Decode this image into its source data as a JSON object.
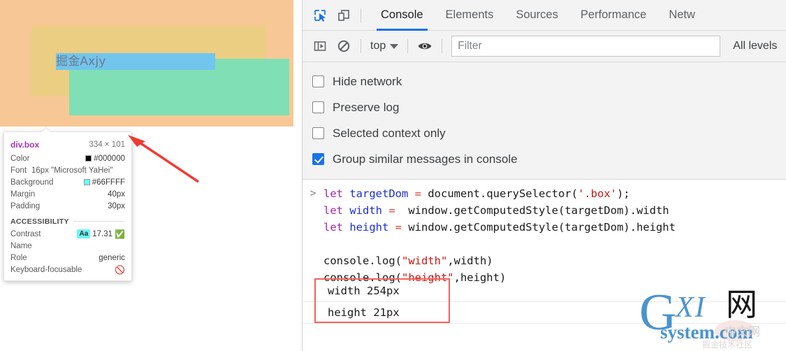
{
  "page": {
    "inspected_text": "掘金Axjy"
  },
  "inspect_tooltip": {
    "selector": "div.box",
    "dimensions": "334 × 101",
    "rows": [
      {
        "key": "Color",
        "value": "#000000",
        "swatch": "#000000"
      },
      {
        "key": "Background",
        "value": "#66FFFF",
        "swatch": "#66FFFF"
      },
      {
        "key": "Margin",
        "value": "40px"
      },
      {
        "key": "Padding",
        "value": "30px"
      }
    ],
    "font_key": "Font",
    "font_value": "16px \"Microsoft YaHei\"",
    "accessibility": {
      "heading": "ACCESSIBILITY",
      "contrast_key": "Contrast",
      "contrast_chip": "Aa",
      "contrast_value": "17.31",
      "contrast_status_icon": "check-circle-icon",
      "name_key": "Name",
      "name_value": "",
      "role_key": "Role",
      "role_value": "generic",
      "focusable_key": "Keyboard-focusable",
      "focusable_status_icon": "not-allowed-icon"
    }
  },
  "devtools": {
    "toolbar": {
      "inspect_icon": "inspect-element-icon",
      "device_icon": "device-toolbar-icon"
    },
    "tabs": [
      {
        "label": "Console",
        "active": true
      },
      {
        "label": "Elements",
        "active": false
      },
      {
        "label": "Sources",
        "active": false
      },
      {
        "label": "Performance",
        "active": false
      },
      {
        "label": "Netw",
        "active": false
      }
    ],
    "filterbar": {
      "sidebar_icon": "console-sidebar-icon",
      "clear_icon": "clear-console-icon",
      "context": "top",
      "eye_icon": "live-expression-icon",
      "filter_placeholder": "Filter",
      "levels": "All levels"
    },
    "settings": [
      {
        "label": "Hide network",
        "checked": false
      },
      {
        "label": "Preserve log",
        "checked": false
      },
      {
        "label": "Selected context only",
        "checked": false
      },
      {
        "label": "Group similar messages in console",
        "checked": true
      }
    ],
    "console": {
      "prompt": ">",
      "code_lines": [
        [
          {
            "t": "let ",
            "c": "k-let"
          },
          {
            "t": "targetDom ",
            "c": "k-var"
          },
          {
            "t": "= ",
            "c": "k-op"
          },
          {
            "t": "document.querySelector(",
            "c": "k-plain"
          },
          {
            "t": "'.box'",
            "c": "k-str"
          },
          {
            "t": ");",
            "c": "k-plain"
          }
        ],
        [
          {
            "t": "let ",
            "c": "k-let"
          },
          {
            "t": "width ",
            "c": "k-var"
          },
          {
            "t": "= ",
            "c": "k-op"
          },
          {
            "t": " window.getComputedStyle(targetDom).width",
            "c": "k-plain"
          }
        ],
        [
          {
            "t": "let ",
            "c": "k-let"
          },
          {
            "t": "height ",
            "c": "k-var"
          },
          {
            "t": "= ",
            "c": "k-op"
          },
          {
            "t": "window.getComputedStyle(targetDom).height",
            "c": "k-plain"
          }
        ],
        [],
        [
          {
            "t": "console.log(",
            "c": "k-plain"
          },
          {
            "t": "\"width\"",
            "c": "k-str"
          },
          {
            "t": ",width)",
            "c": "k-plain"
          }
        ],
        [
          {
            "t": "console.log(",
            "c": "k-plain"
          },
          {
            "t": "\"height\"",
            "c": "k-str"
          },
          {
            "t": ",height)",
            "c": "k-plain"
          }
        ]
      ],
      "outputs": [
        "width 254px",
        "height 21px"
      ]
    }
  },
  "watermark": {
    "g": "G",
    "xi": "XI",
    "wang": "网",
    "system": "system.com",
    "cn_right": "中文网",
    "cn_bottom": "掘金技术社区"
  },
  "colors": {
    "accent_blue": "#1a73e8",
    "margin_overlay": "#f7c895",
    "padding_overlay": "#ecce83",
    "content_overlay": "#80dfb4",
    "selection_blue": "#72c5ec",
    "annotation_red": "#f0635c"
  }
}
